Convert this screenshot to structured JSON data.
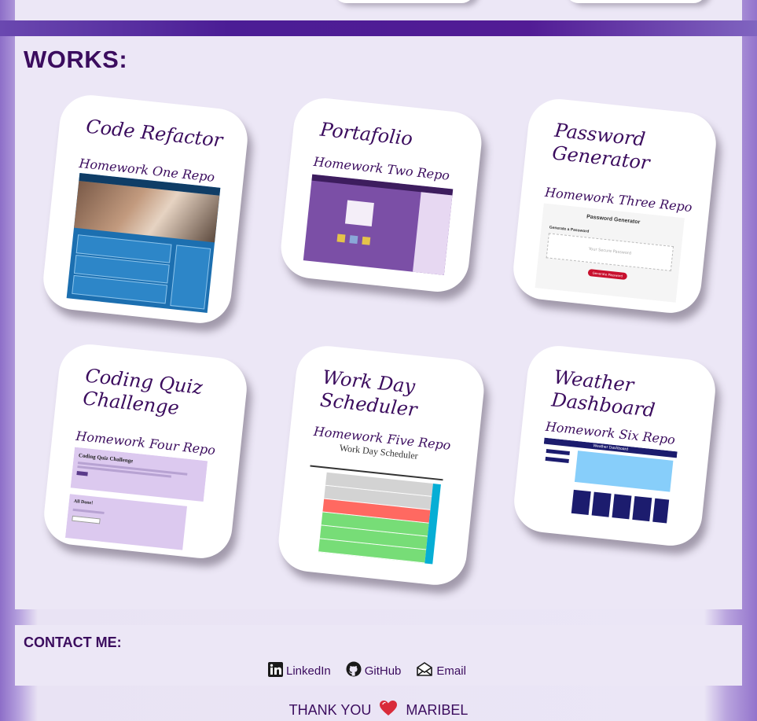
{
  "works": {
    "title": "WORKS:",
    "cards": [
      {
        "title": "Code Refactor",
        "repo": "Homework One Repo"
      },
      {
        "title": "Portafolio",
        "repo": "Homework Two Repo"
      },
      {
        "title": "Password Generator",
        "repo": "Homework Three Repo"
      },
      {
        "title": "Coding Quiz Challenge",
        "repo": "Homework Four Repo"
      },
      {
        "title": "Work Day Scheduler",
        "repo": "Homework Five Repo"
      },
      {
        "title": "Weather Dashboard",
        "repo": "Homework Six Repo"
      }
    ]
  },
  "screens": {
    "password_heading": "Password Generator",
    "password_sub": "Generate a Password",
    "password_placeholder": "Your Secure Password",
    "password_button": "Generate Password",
    "quiz_heading": "Coding Quiz Challenge",
    "quiz_done": "All Done!",
    "scheduler_heading": "Work Day Scheduler",
    "weather_heading": "Weather Dashboard"
  },
  "contact": {
    "title": "CONTACT ME:",
    "links": [
      {
        "label": "LinkedIn",
        "icon": "linkedin-icon"
      },
      {
        "label": "GitHub",
        "icon": "github-icon"
      },
      {
        "label": "Email",
        "icon": "email-icon"
      }
    ]
  },
  "footer": {
    "thanks": "THANK YOU",
    "name": "MARIBEL",
    "heart_color": "#d92b3a"
  },
  "colors": {
    "accent": "#3b0c5e",
    "band": "#4b1d95",
    "panel": "#ece7f6"
  }
}
